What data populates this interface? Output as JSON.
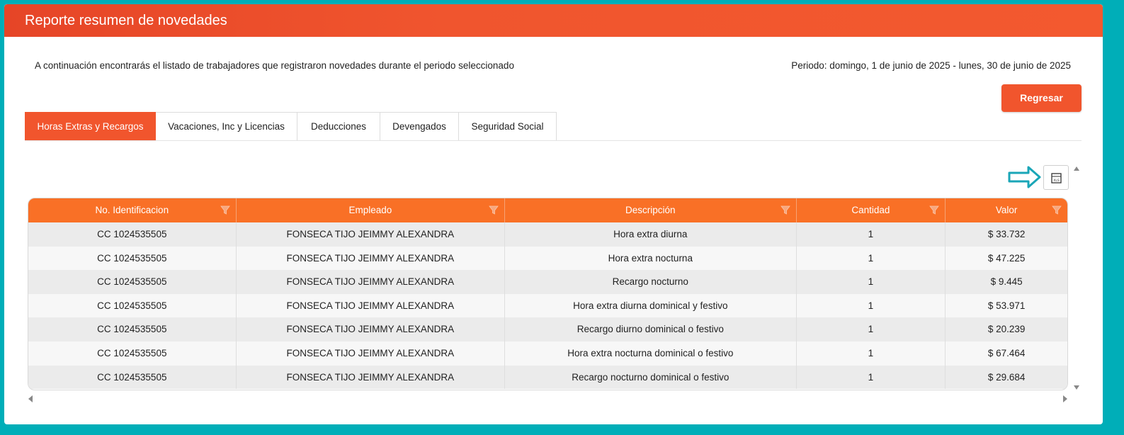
{
  "header": {
    "title": "Reporte resumen de novedades"
  },
  "intro_text": "A continuación encontrarás el listado de trabajadores que registraron novedades durante el periodo seleccionado",
  "period_text": "Periodo: domingo, 1 de junio de 2025 - lunes, 30 de junio de 2025",
  "back_button": "Regresar",
  "tabs": [
    {
      "label": "Horas Extras y Recargos",
      "active": true
    },
    {
      "label": "Vacaciones, Inc y Licencias",
      "active": false
    },
    {
      "label": "Deducciones",
      "active": false
    },
    {
      "label": "Devengados",
      "active": false
    },
    {
      "label": "Seguridad Social",
      "active": false
    }
  ],
  "export_icon": "excel-export-icon",
  "table": {
    "columns": [
      "No. Identificacion",
      "Empleado",
      "Descripción",
      "Cantidad",
      "Valor"
    ],
    "rows": [
      [
        "CC 1024535505",
        "FONSECA TIJO JEIMMY ALEXANDRA",
        "Hora extra diurna",
        "1",
        "$ 33.732"
      ],
      [
        "CC 1024535505",
        "FONSECA TIJO JEIMMY ALEXANDRA",
        "Hora extra nocturna",
        "1",
        "$ 47.225"
      ],
      [
        "CC 1024535505",
        "FONSECA TIJO JEIMMY ALEXANDRA",
        "Recargo nocturno",
        "1",
        "$ 9.445"
      ],
      [
        "CC 1024535505",
        "FONSECA TIJO JEIMMY ALEXANDRA",
        "Hora extra diurna dominical y festivo",
        "1",
        "$ 53.971"
      ],
      [
        "CC 1024535505",
        "FONSECA TIJO JEIMMY ALEXANDRA",
        "Recargo diurno dominical o festivo",
        "1",
        "$ 20.239"
      ],
      [
        "CC 1024535505",
        "FONSECA TIJO JEIMMY ALEXANDRA",
        "Hora extra nocturna dominical o festivo",
        "1",
        "$ 67.464"
      ],
      [
        "CC 1024535505",
        "FONSECA TIJO JEIMMY ALEXANDRA",
        "Recargo nocturno dominical o festivo",
        "1",
        "$ 29.684"
      ]
    ]
  },
  "colors": {
    "accent": "#f1552d",
    "table_header": "#f97026",
    "frame": "#00aeb8"
  }
}
